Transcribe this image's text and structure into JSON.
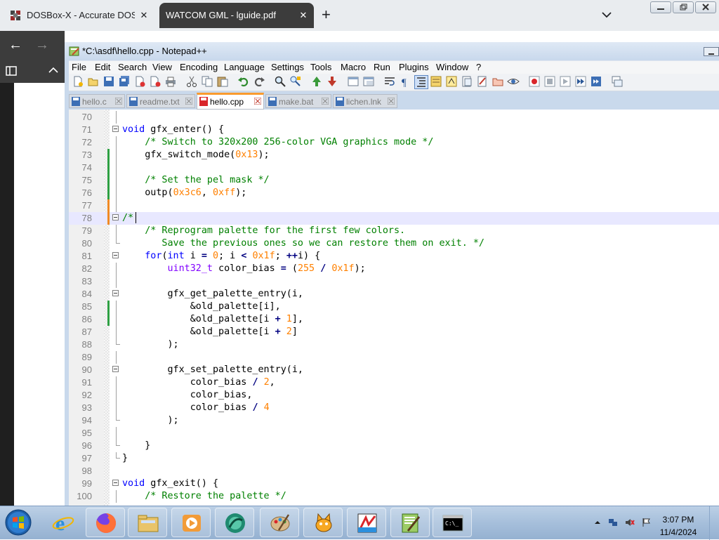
{
  "browser": {
    "tabs": [
      {
        "title": "DOSBox-X - Accurate DOS emu",
        "close": "✕",
        "active": false
      },
      {
        "title": "WATCOM GML - lguide.pdf",
        "close": "✕",
        "active": true
      }
    ],
    "new_tab": "+",
    "back": "←",
    "forward": "→"
  },
  "npp": {
    "title": "*C:\\asdf\\hello.cpp - Notepad++",
    "menu": [
      "File",
      "Edit",
      "Search",
      "View",
      "Encoding",
      "Language",
      "Settings",
      "Tools",
      "Macro",
      "Run",
      "Plugins",
      "Window",
      "?"
    ],
    "file_tabs": [
      {
        "name": "hello.c",
        "active": false
      },
      {
        "name": "readme.txt",
        "active": false
      },
      {
        "name": "hello.cpp",
        "active": true
      },
      {
        "name": "make.bat",
        "active": false
      },
      {
        "name": "lichen.lnk",
        "active": false
      }
    ],
    "colors": {
      "comment": "#008000",
      "number": "#ff8000",
      "keyword": "#0000ff",
      "type": "#8000ff",
      "saved_change": "#2ea043",
      "unsaved_change": "#f08a24",
      "active_tab_accent": "#fa9b2e"
    }
  },
  "code_lines": [
    {
      "n": "70",
      "text": "",
      "change": "",
      "fold": "line"
    },
    {
      "n": "71",
      "text": "void gfx_enter() {",
      "change": "",
      "fold": "box"
    },
    {
      "n": "72",
      "text": "    /* Switch to 320x200 256-color VGA graphics mode */",
      "change": "",
      "fold": "line"
    },
    {
      "n": "73",
      "text": "    gfx_switch_mode(0x13);",
      "change": "saved",
      "fold": "line"
    },
    {
      "n": "74",
      "text": "",
      "change": "saved",
      "fold": "line"
    },
    {
      "n": "75",
      "text": "    /* Set the pel mask */",
      "change": "saved",
      "fold": "line"
    },
    {
      "n": "76",
      "text": "    outp(0x3c6, 0xff);",
      "change": "saved",
      "fold": "line"
    },
    {
      "n": "77",
      "text": "",
      "change": "unsaved",
      "fold": "line"
    },
    {
      "n": "78",
      "text": "/*",
      "change": "unsaved",
      "fold": "box"
    },
    {
      "n": "79",
      "text": "    /* Reprogram palette for the first few colors.",
      "change": "",
      "fold": "line"
    },
    {
      "n": "80",
      "text": "       Save the previous ones so we can restore them on exit. */",
      "change": "",
      "fold": "tick"
    },
    {
      "n": "81",
      "text": "    for(int i = 0; i < 0x1f; ++i) {",
      "change": "",
      "fold": "box"
    },
    {
      "n": "82",
      "text": "        uint32_t color_bias = (255 / 0x1f);",
      "change": "",
      "fold": "line"
    },
    {
      "n": "83",
      "text": "",
      "change": "",
      "fold": "line"
    },
    {
      "n": "84",
      "text": "        gfx_get_palette_entry(i,",
      "change": "",
      "fold": "box"
    },
    {
      "n": "85",
      "text": "            &old_palette[i],",
      "change": "saved",
      "fold": "line"
    },
    {
      "n": "86",
      "text": "            &old_palette[i + 1],",
      "change": "saved",
      "fold": "line"
    },
    {
      "n": "87",
      "text": "            &old_palette[i + 2]",
      "change": "",
      "fold": "line"
    },
    {
      "n": "88",
      "text": "        );",
      "change": "",
      "fold": "tick"
    },
    {
      "n": "89",
      "text": "",
      "change": "",
      "fold": "line"
    },
    {
      "n": "90",
      "text": "        gfx_set_palette_entry(i,",
      "change": "",
      "fold": "box"
    },
    {
      "n": "91",
      "text": "            color_bias / 2,",
      "change": "",
      "fold": "line"
    },
    {
      "n": "92",
      "text": "            color_bias,",
      "change": "",
      "fold": "line"
    },
    {
      "n": "93",
      "text": "            color_bias / 4",
      "change": "",
      "fold": "line"
    },
    {
      "n": "94",
      "text": "        );",
      "change": "",
      "fold": "tick"
    },
    {
      "n": "95",
      "text": "",
      "change": "",
      "fold": "line"
    },
    {
      "n": "96",
      "text": "    }",
      "change": "",
      "fold": "tick"
    },
    {
      "n": "97",
      "text": "}",
      "change": "",
      "fold": "tick"
    },
    {
      "n": "98",
      "text": "",
      "change": "",
      "fold": ""
    },
    {
      "n": "99",
      "text": "void gfx_exit() {",
      "change": "",
      "fold": "box"
    },
    {
      "n": "100",
      "text": "    /* Restore the palette */",
      "change": "",
      "fold": "line"
    }
  ],
  "taskbar": {
    "apps": [
      "internet-explorer",
      "firefox",
      "file-explorer",
      "media-player",
      "app-teal",
      "paint",
      "scratch",
      "paint-tool",
      "notepad-plus-plus",
      "command-prompt"
    ],
    "clock_time": "3:07 PM",
    "clock_date": "11/4/2024"
  }
}
